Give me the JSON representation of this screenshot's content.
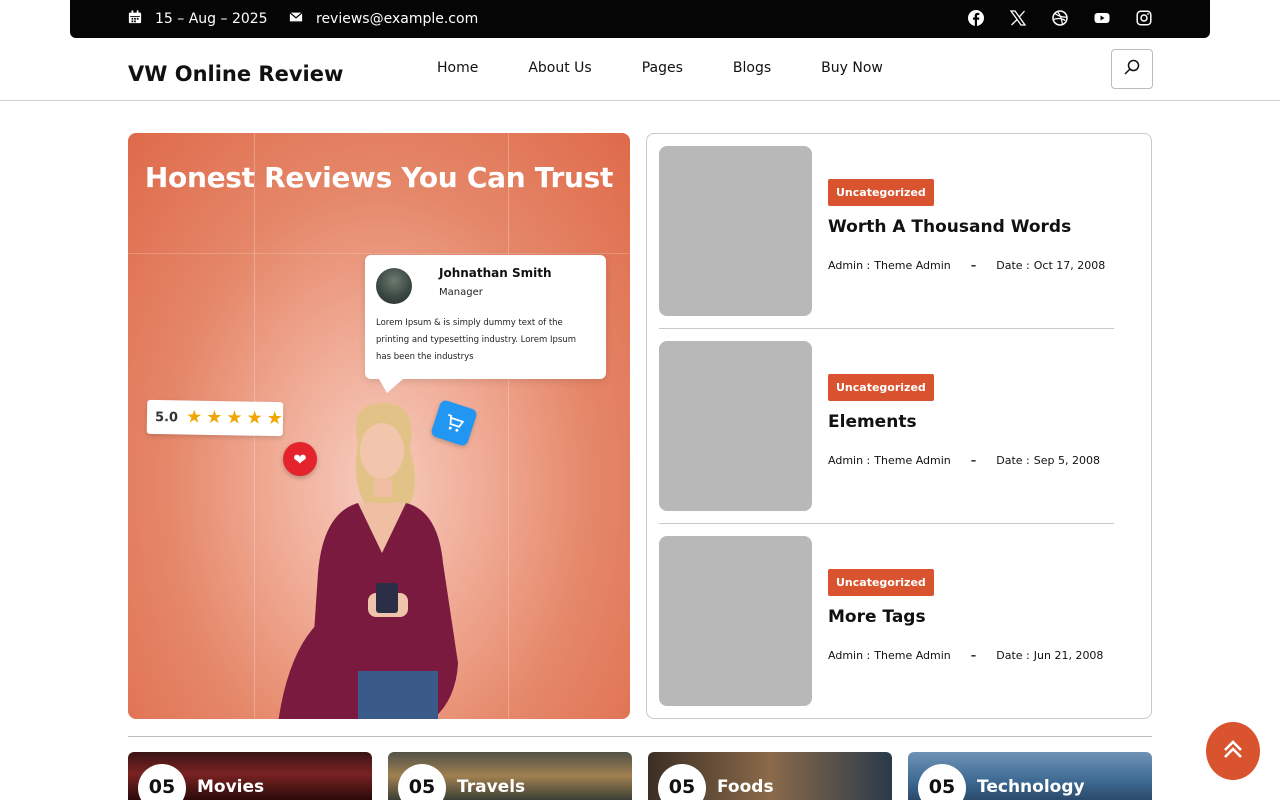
{
  "topbar": {
    "date": "15 – Aug – 2025",
    "email": "reviews@example.com",
    "social": [
      "facebook-icon",
      "x-icon",
      "dribbble-icon",
      "youtube-icon",
      "instagram-icon"
    ]
  },
  "header": {
    "logo": "VW Online Review",
    "nav": [
      "Home",
      "About Us",
      "Pages",
      "Blogs",
      "Buy Now"
    ]
  },
  "hero": {
    "title": "Honest Reviews You Can Trust",
    "testimonial": {
      "name": "Johnathan Smith",
      "role": "Manager",
      "text": "Lorem Ipsum & is simply dummy text of the printing and typesetting industry. Lorem Ipsum has been the industrys"
    },
    "rating": "5.0",
    "stars": 5
  },
  "posts": [
    {
      "category": "Uncategorized",
      "title": "Worth A Thousand Words",
      "admin_label": "Admin :",
      "author": "Theme Admin",
      "date_label": "Date :",
      "date": "Oct 17, 2008"
    },
    {
      "category": "Uncategorized",
      "title": "Elements",
      "admin_label": "Admin :",
      "author": "Theme Admin",
      "date_label": "Date :",
      "date": "Sep 5, 2008"
    },
    {
      "category": "Uncategorized",
      "title": "More Tags",
      "admin_label": "Admin :",
      "author": "Theme Admin",
      "date_label": "Date :",
      "date": "Jun 21, 2008"
    }
  ],
  "categories": [
    {
      "count": "05",
      "label": "Movies"
    },
    {
      "count": "05",
      "label": "Travels"
    },
    {
      "count": "05",
      "label": "Foods"
    },
    {
      "count": "05",
      "label": "Technology"
    }
  ],
  "colors": {
    "accent": "#d9532e",
    "topbar": "#050505",
    "thumb": "#b9b8b9"
  }
}
